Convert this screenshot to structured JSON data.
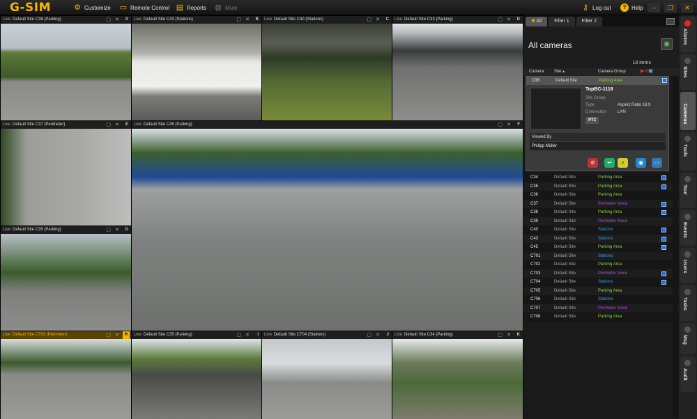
{
  "app": {
    "logo": "G-SIM",
    "menu": [
      {
        "label": "Customize",
        "icon": "gear-icon"
      },
      {
        "label": "Remote Control",
        "icon": "monitor-icon"
      },
      {
        "label": "Reports",
        "icon": "report-icon"
      },
      {
        "label": "Mute",
        "icon": "mute-icon"
      }
    ],
    "logout": "Log out",
    "help": "Help"
  },
  "cells": [
    {
      "live": "Live",
      "title": "Default Site C38 (Parking)",
      "letter": "A"
    },
    {
      "live": "Live",
      "title": "Default Site C43 (Stations)",
      "letter": "B"
    },
    {
      "live": "Live",
      "title": "Default Site C40 (Stations)",
      "letter": "C"
    },
    {
      "live": "Live",
      "title": "Default Site C33 (Parking)",
      "letter": "D"
    },
    {
      "live": "Live",
      "title": "Default Site C37 (Perimeter)",
      "letter": "E"
    },
    {
      "live": "Live",
      "title": "Default Site C45 (Parking)",
      "letter": "F"
    },
    {
      "live": "Live",
      "title": "Default Site C35 (Parking)",
      "letter": "G"
    },
    {
      "live": "Live",
      "title": "Default Site C703 (Perimeter)",
      "letter": "H"
    },
    {
      "live": "Live",
      "title": "Default Site C35 (Parking)",
      "letter": "I"
    },
    {
      "live": "Live",
      "title": "Default Site C704 (Stations)",
      "letter": "J"
    },
    {
      "live": "Live",
      "title": "Default Site C34 (Parking)",
      "letter": "K"
    }
  ],
  "panel": {
    "tabs": [
      "All",
      "Filter 1",
      "Filter 2"
    ],
    "title": "All cameras",
    "count": "18 items",
    "columns": {
      "camera": "Camera",
      "site": "Site ▴",
      "group": "Camera Group"
    },
    "selected": {
      "camera": "C33",
      "site": "Default Site",
      "group": "Parking Area",
      "name": "TopBC-1118",
      "site_group_label": "Site Group",
      "type_label": "Type",
      "type_value": "Aspect Ratio 16:9",
      "connection_label": "Connection",
      "connection_value": "LAN",
      "ptz": "PTZ",
      "viewed_by_label": "Viewed By",
      "viewer": "Philipp Müller"
    },
    "rows": [
      {
        "camera": "C34",
        "site": "Default Site",
        "group": "Parking Area",
        "color": "#8bd13a",
        "icon": true
      },
      {
        "camera": "C35",
        "site": "Default Site",
        "group": "Parking Area",
        "color": "#8bd13a",
        "icon": true
      },
      {
        "camera": "C36",
        "site": "Default Site",
        "group": "Parking Area",
        "color": "#8bd13a",
        "icon": false
      },
      {
        "camera": "C37",
        "site": "Default Site",
        "group": "Perimeter fence",
        "color": "#b94ad8",
        "icon": true
      },
      {
        "camera": "C38",
        "site": "Default Site",
        "group": "Parking Area",
        "color": "#8bd13a",
        "icon": true
      },
      {
        "camera": "C39",
        "site": "Default Site",
        "group": "Perimeter fence",
        "color": "#b94ad8",
        "icon": false
      },
      {
        "camera": "C40",
        "site": "Default Site",
        "group": "Stations",
        "color": "#3a9bde",
        "icon": true
      },
      {
        "camera": "C43",
        "site": "Default Site",
        "group": "Stations",
        "color": "#3a9bde",
        "icon": true
      },
      {
        "camera": "C45",
        "site": "Default Site",
        "group": "Parking Area",
        "color": "#8bd13a",
        "icon": true
      },
      {
        "camera": "C701",
        "site": "Default Site",
        "group": "Stations",
        "color": "#3a9bde",
        "icon": false
      },
      {
        "camera": "C702",
        "site": "Default Site",
        "group": "Parking Area",
        "color": "#8bd13a",
        "icon": false
      },
      {
        "camera": "C703",
        "site": "Default Site",
        "group": "Perimeter fence",
        "color": "#b94ad8",
        "icon": true
      },
      {
        "camera": "C704",
        "site": "Default Site",
        "group": "Stations",
        "color": "#3a9bde",
        "icon": true
      },
      {
        "camera": "C705",
        "site": "Default Site",
        "group": "Parking Area",
        "color": "#8bd13a",
        "icon": false
      },
      {
        "camera": "C706",
        "site": "Default Site",
        "group": "Stations",
        "color": "#3a9bde",
        "icon": false
      },
      {
        "camera": "C707",
        "site": "Default Site",
        "group": "Perimeter fence",
        "color": "#b94ad8",
        "icon": false
      },
      {
        "camera": "C708",
        "site": "Default Site",
        "group": "Parking Area",
        "color": "#8bd13a",
        "icon": false
      }
    ]
  },
  "rail": [
    "Alarms",
    "Sites",
    "Cameras",
    "Tools",
    "Tour",
    "Events",
    "Users",
    "Tasks",
    "Msg",
    "Audit"
  ],
  "colors": {
    "accent": "#f2b600",
    "parking": "#8bd13a",
    "stations": "#3a9bde",
    "perimeter": "#b94ad8"
  }
}
